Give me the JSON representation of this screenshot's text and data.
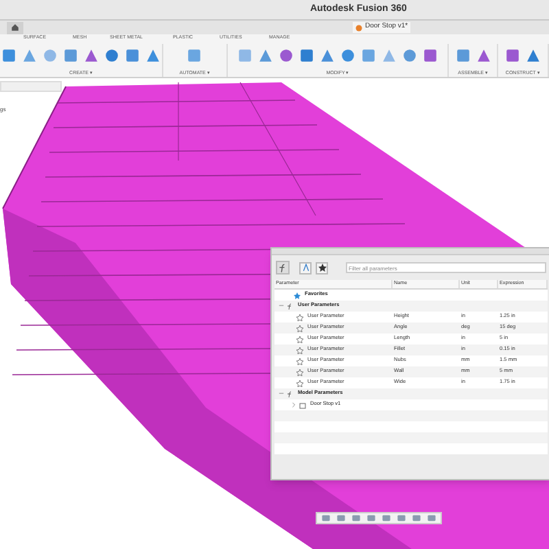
{
  "window": {
    "title": "Autodesk Fusion 360"
  },
  "document_tab": {
    "label": "Door Stop v1*",
    "selected": true
  },
  "ribbon_tabs": [
    "SURFACE",
    "MESH",
    "SHEET METAL",
    "PLASTIC",
    "UTILITIES",
    "MANAGE"
  ],
  "ribbon_groups": [
    {
      "label": "CREATE ▾"
    },
    {
      "label": "AUTOMATE ▾"
    },
    {
      "label": "MODIFY ▾"
    },
    {
      "label": "ASSEMBLE ▾"
    },
    {
      "label": "CONSTRUCT ▾"
    }
  ],
  "browser": {
    "fragment": "gs"
  },
  "parameters_dialog": {
    "search": {
      "placeholder": "Filter all parameters"
    },
    "columns": [
      "Parameter",
      "Name",
      "Unit",
      "Expression"
    ],
    "tree": [
      {
        "kind": "favorites",
        "label": "Favorites"
      },
      {
        "kind": "group",
        "label": "User Parameters",
        "expanded": true,
        "children": [
          {
            "kind": "param",
            "label": "User Parameter",
            "name": "Height",
            "unit": "in",
            "expression": "1.25 in"
          },
          {
            "kind": "param",
            "label": "User Parameter",
            "name": "Angle",
            "unit": "deg",
            "expression": "15 deg"
          },
          {
            "kind": "param",
            "label": "User Parameter",
            "name": "Length",
            "unit": "in",
            "expression": "5 in"
          },
          {
            "kind": "param",
            "label": "User Parameter",
            "name": "Fillet",
            "unit": "in",
            "expression": "0.15 in"
          },
          {
            "kind": "param",
            "label": "User Parameter",
            "name": "Nubs",
            "unit": "mm",
            "expression": "1.5 mm"
          },
          {
            "kind": "param",
            "label": "User Parameter",
            "name": "Wall",
            "unit": "mm",
            "expression": "5 mm"
          },
          {
            "kind": "param",
            "label": "User Parameter",
            "name": "Wide",
            "unit": "in",
            "expression": "1.75 in"
          }
        ]
      },
      {
        "kind": "group",
        "label": "Model Parameters",
        "expanded": true,
        "children": [
          {
            "kind": "component",
            "label": "Door Stop v1",
            "expanded": false
          }
        ]
      }
    ]
  }
}
